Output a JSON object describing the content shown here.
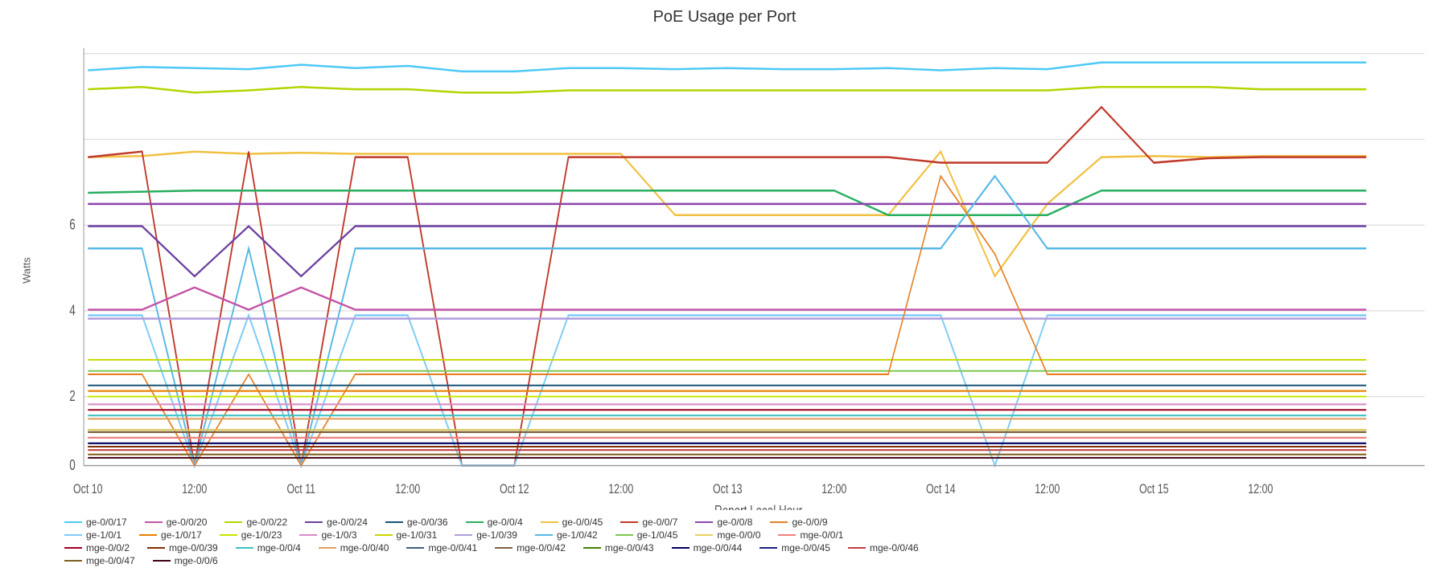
{
  "chart": {
    "title": "PoE Usage per Port",
    "x_axis_label": "Report Local Hour",
    "y_axis_label": "Watts",
    "x_ticks": [
      "Oct 10",
      "12:00",
      "Oct 11",
      "12:00",
      "Oct 12",
      "12:00",
      "Oct 13",
      "12:00",
      "Oct 14",
      "12:00",
      "Oct 15",
      "12:00"
    ],
    "y_ticks": [
      "0",
      "2",
      "4",
      "6"
    ],
    "background_color": "#ffffff",
    "grid_color": "#e0e0e0"
  },
  "legend": {
    "rows": [
      [
        {
          "label": "ge-0/0/17",
          "color": "#4dc9f6"
        },
        {
          "label": "ge-0/0/20",
          "color": "#c455a8"
        },
        {
          "label": "ge-0/0/22",
          "color": "#b5d400"
        },
        {
          "label": "ge-0/0/24",
          "color": "#6b3fa0"
        },
        {
          "label": "ge-0/0/36",
          "color": "#1a5276"
        },
        {
          "label": "ge-0/0/4",
          "color": "#27ae60"
        },
        {
          "label": "ge-0/0/45",
          "color": "#f0c040"
        },
        {
          "label": "ge-0/0/7",
          "color": "#c0392b"
        },
        {
          "label": "ge-0/0/8",
          "color": "#8e44ad"
        },
        {
          "label": "ge-0/0/9",
          "color": "#e67e22"
        }
      ],
      [
        {
          "label": "ge-1/0/1",
          "color": "#7ecbf7"
        },
        {
          "label": "ge-1/0/17",
          "color": "#e97f00"
        },
        {
          "label": "ge-1/0/23",
          "color": "#c8e600"
        },
        {
          "label": "ge-1/0/3",
          "color": "#d98cc8"
        },
        {
          "label": "ge-1/0/31",
          "color": "#c8d800"
        },
        {
          "label": "ge-1/0/39",
          "color": "#b09cde"
        },
        {
          "label": "ge-1/0/42",
          "color": "#56b8e6"
        },
        {
          "label": "ge-1/0/45",
          "color": "#7ec850"
        },
        {
          "label": "mge-0/0/0",
          "color": "#e8d060"
        },
        {
          "label": "mge-0/0/1",
          "color": "#f08080"
        }
      ],
      [
        {
          "label": "mge-0/0/2",
          "color": "#a00020"
        },
        {
          "label": "mge-0/0/39",
          "color": "#803000"
        },
        {
          "label": "mge-0/0/4",
          "color": "#40c0c0"
        },
        {
          "label": "mge-0/0/40",
          "color": "#e0a060"
        },
        {
          "label": "mge-0/0/41",
          "color": "#406080"
        },
        {
          "label": "mge-0/0/42",
          "color": "#806040"
        },
        {
          "label": "mge-0/0/43",
          "color": "#408000"
        },
        {
          "label": "mge-0/0/44",
          "color": "#000060"
        },
        {
          "label": "mge-0/0/45",
          "color": "#202080"
        },
        {
          "label": "mge-0/0/46",
          "color": "#c04040"
        }
      ],
      [
        {
          "label": "mge-0/0/47",
          "color": "#806020"
        },
        {
          "label": "mge-0/0/6",
          "color": "#400010"
        }
      ]
    ]
  }
}
